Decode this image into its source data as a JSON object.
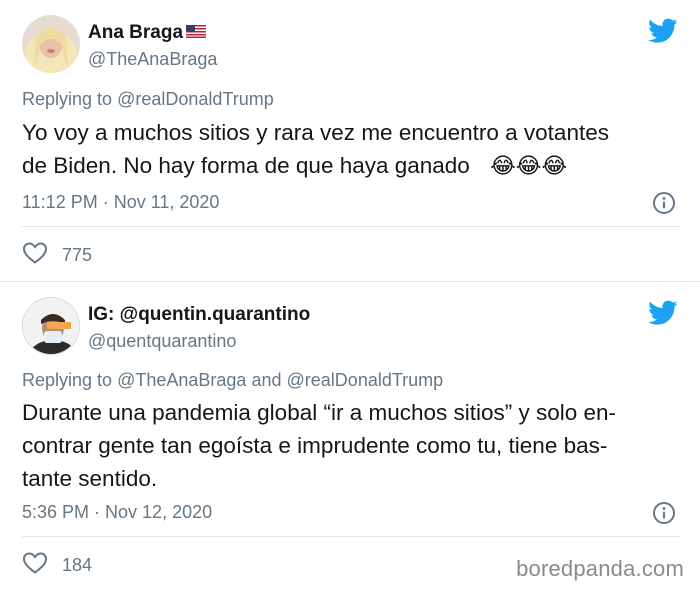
{
  "tweets": [
    {
      "display_name": "Ana Braga",
      "flag_icon": "us-flag-icon",
      "handle": "@TheAnaBraga",
      "replying_prefix": "Replying to",
      "replying_to": "@realDonaldTrump",
      "text_line1": "Yo voy a muchos sitios y rara vez me encuentro a votantes",
      "text_line2": "de Biden. No hay forma de que haya ganado",
      "emoji": "😂😂😂",
      "timestamp": "11:12 PM · Nov 11, 2020",
      "likes": "775"
    },
    {
      "display_name": "IG: @quentin.quarantino",
      "handle": "@quentquarantino",
      "replying_prefix": "Replying to",
      "replying_to_1": "@TheAnaBraga",
      "replying_and": "and",
      "replying_to_2": "@realDonaldTrump",
      "text_line1": "Durante una pandemia global “ir a muchos sitios” y solo en-",
      "text_line2": "contrar gente tan egoísta e imprudente como tu, tiene bas-",
      "text_line3": "tante sentido.",
      "timestamp": "5:36 PM · Nov 12, 2020",
      "likes": "184"
    }
  ],
  "watermark": "boredpanda.com",
  "colors": {
    "twitter_blue": "#1da1f2",
    "muted_text": "#657786",
    "primary_text": "#14171a",
    "divider": "#e1e8ed"
  }
}
